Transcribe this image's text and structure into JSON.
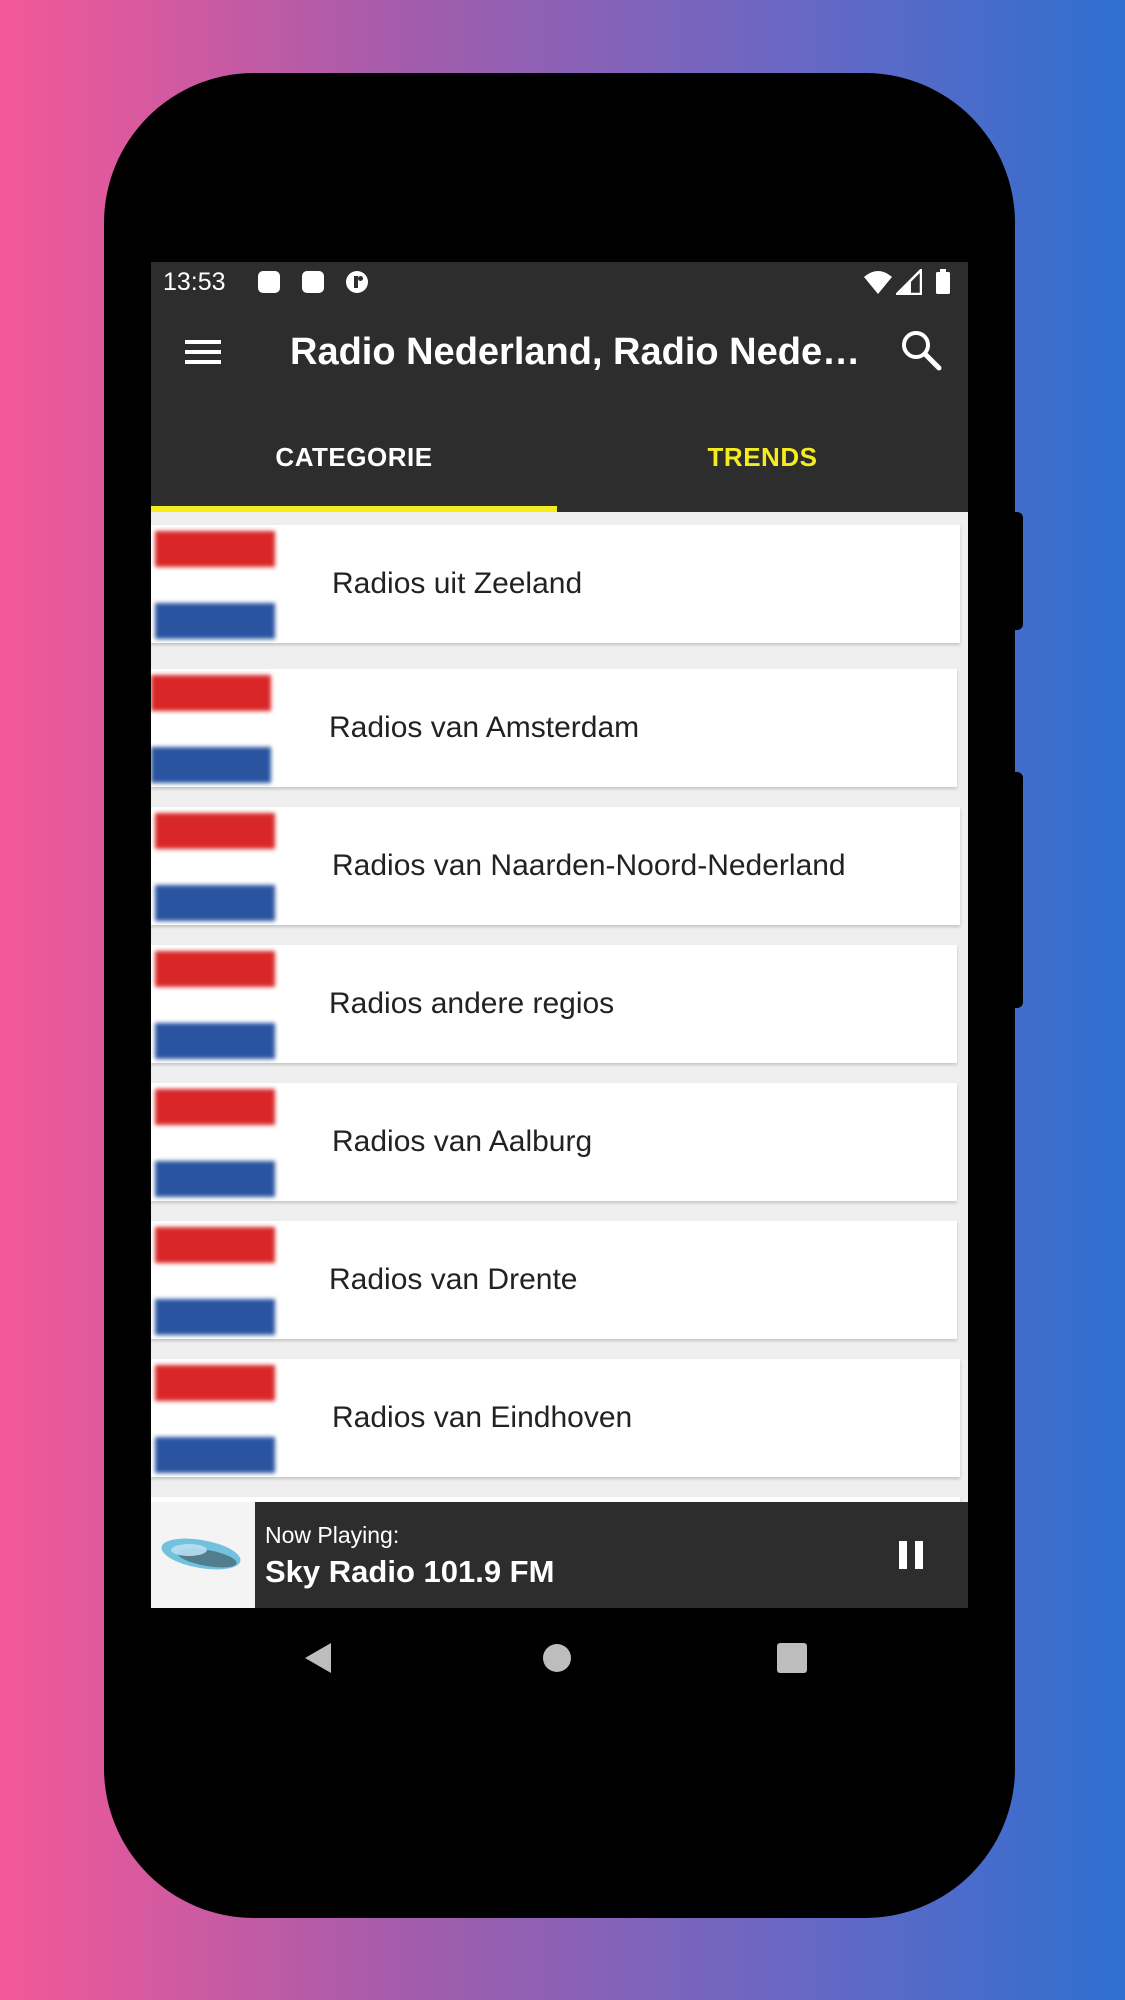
{
  "status_bar": {
    "time": "13:53",
    "notification_icons": [
      "notification-square-icon",
      "notification-square-icon",
      "notification-round-icon"
    ],
    "system_icons": [
      "wifi-icon",
      "signal-icon",
      "battery-icon"
    ]
  },
  "app_bar": {
    "menu_icon": "hamburger-menu-icon",
    "title": "Radio Nederland, Radio Nederland Online",
    "search_icon": "search-icon"
  },
  "tabs": [
    {
      "label": "CATEGORIE",
      "active": true
    },
    {
      "label": "TRENDS",
      "active": false
    }
  ],
  "colors": {
    "bar_background": "#2d2d2d",
    "accent_yellow": "#f4ec1d",
    "flag_red": "#d92727",
    "flag_blue": "#2a54a0"
  },
  "categories": [
    {
      "label": "Radios uit Zeeland",
      "icon": "netherlands-flag-icon"
    },
    {
      "label": "Radios van Amsterdam",
      "icon": "netherlands-flag-icon"
    },
    {
      "label": "Radios van Naarden-Noord-Nederland",
      "icon": "netherlands-flag-icon"
    },
    {
      "label": "Radios andere regios",
      "icon": "netherlands-flag-icon"
    },
    {
      "label": "Radios van Aalburg",
      "icon": "netherlands-flag-icon"
    },
    {
      "label": "Radios van Drente",
      "icon": "netherlands-flag-icon"
    },
    {
      "label": "Radios van Eindhoven",
      "icon": "netherlands-flag-icon"
    }
  ],
  "now_playing": {
    "label": "Now Playing:",
    "station": "Sky Radio 101.9 FM",
    "control_icon": "pause-icon"
  },
  "nav_bar": {
    "buttons": [
      "back-icon",
      "home-icon",
      "recents-icon"
    ]
  }
}
